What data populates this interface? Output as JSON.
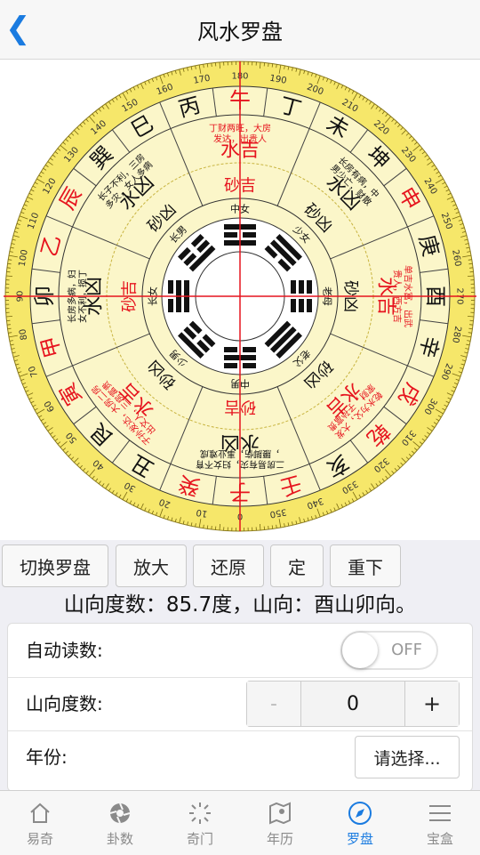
{
  "nav": {
    "title": "风水罗盘",
    "back_icon": "chevron-left-icon"
  },
  "compass": {
    "degree_labels": [
      "0",
      "10",
      "20",
      "30",
      "40",
      "50",
      "60",
      "70",
      "80",
      "90",
      "100",
      "110",
      "120",
      "130",
      "140",
      "150",
      "160",
      "170",
      "180",
      "190",
      "200",
      "210",
      "220",
      "230",
      "240",
      "250",
      "260",
      "270",
      "280",
      "290",
      "300",
      "310",
      "320",
      "330",
      "340",
      "350"
    ],
    "mountains": [
      {
        "name": "子",
        "color": "#e6141e"
      },
      {
        "name": "癸",
        "color": "#e6141e"
      },
      {
        "name": "丑",
        "color": "#111111"
      },
      {
        "name": "艮",
        "color": "#111111"
      },
      {
        "name": "寅",
        "color": "#e6141e"
      },
      {
        "name": "甲",
        "color": "#e6141e"
      },
      {
        "name": "卯",
        "color": "#111111"
      },
      {
        "name": "乙",
        "color": "#e6141e"
      },
      {
        "name": "辰",
        "color": "#e6141e"
      },
      {
        "name": "巽",
        "color": "#111111"
      },
      {
        "name": "巳",
        "color": "#111111"
      },
      {
        "name": "丙",
        "color": "#111111"
      },
      {
        "name": "午",
        "color": "#e6141e"
      },
      {
        "name": "丁",
        "color": "#111111"
      },
      {
        "name": "未",
        "color": "#111111"
      },
      {
        "name": "坤",
        "color": "#111111"
      },
      {
        "name": "申",
        "color": "#e6141e"
      },
      {
        "name": "庚",
        "color": "#111111"
      },
      {
        "name": "酉",
        "color": "#111111"
      },
      {
        "name": "辛",
        "color": "#111111"
      },
      {
        "name": "戌",
        "color": "#e6141e"
      },
      {
        "name": "乾",
        "color": "#e6141e"
      },
      {
        "name": "亥",
        "color": "#111111"
      },
      {
        "name": "壬",
        "color": "#e6141e"
      }
    ],
    "sectors": [
      {
        "label": "水凶",
        "color": "#111111",
        "desc": "二房易有灾，妇女不育，腰脚伤，事业难成"
      },
      {
        "label": "水吉",
        "color": "#e6141e",
        "desc": "子孙发达，大房二房出文人，三房富贵"
      },
      {
        "label": "水凶",
        "color": "#111111",
        "desc": "长房多病，妇女不利，损丁"
      },
      {
        "label": "水凶",
        "color": "#111111",
        "desc": "长子不利，三房多灾，女人多病"
      },
      {
        "label": "水吉",
        "color": "#e6141e",
        "desc": "丁财两旺，大房发达，出贵人"
      },
      {
        "label": "水凶",
        "color": "#111111",
        "desc": "长房有病，中男少亡，财散"
      },
      {
        "label": "水吉",
        "color": "#e6141e",
        "desc": "单吉水富，出武贵人，西方吉"
      },
      {
        "label": "水吉",
        "color": "#e6141e",
        "desc": "乾水为父，大发家财，子孙富贵"
      }
    ],
    "inner_ring": [
      {
        "label": "砂吉",
        "color": "#e6141e"
      },
      {
        "label": "砂凶",
        "color": "#111111"
      },
      {
        "label": "砂吉",
        "color": "#e6141e"
      },
      {
        "label": "砂凶",
        "color": "#111111"
      },
      {
        "label": "砂吉",
        "color": "#e6141e"
      },
      {
        "label": "砂凶",
        "color": "#111111"
      },
      {
        "label": "砂凶",
        "color": "#111111"
      },
      {
        "label": "砂凶",
        "color": "#111111"
      }
    ],
    "family_labels": [
      "中男",
      "少男",
      "长女",
      "长男",
      "中女",
      "少女",
      "老母",
      "老父"
    ]
  },
  "buttons": {
    "switch_compass": "切换罗盘",
    "zoom_in": "放大",
    "reset": "还原",
    "fix": "定",
    "redo": "重下"
  },
  "readout": "山向度数：85.7度，山向：酉山卯向。",
  "form": {
    "auto_read_label": "自动读数:",
    "auto_read_state": "OFF",
    "degree_label": "山向度数:",
    "degree_value": "0",
    "minus": "-",
    "plus": "+",
    "year_label": "年份:",
    "year_placeholder": "请选择..."
  },
  "tabs": [
    {
      "label": "易奇",
      "icon": "house-icon"
    },
    {
      "label": "卦数",
      "icon": "aperture-icon"
    },
    {
      "label": "奇门",
      "icon": "sun-icon"
    },
    {
      "label": "年历",
      "icon": "map-pin-icon"
    },
    {
      "label": "罗盘",
      "icon": "compass-icon",
      "active": true
    },
    {
      "label": "宝盒",
      "icon": "menu-icon"
    }
  ]
}
